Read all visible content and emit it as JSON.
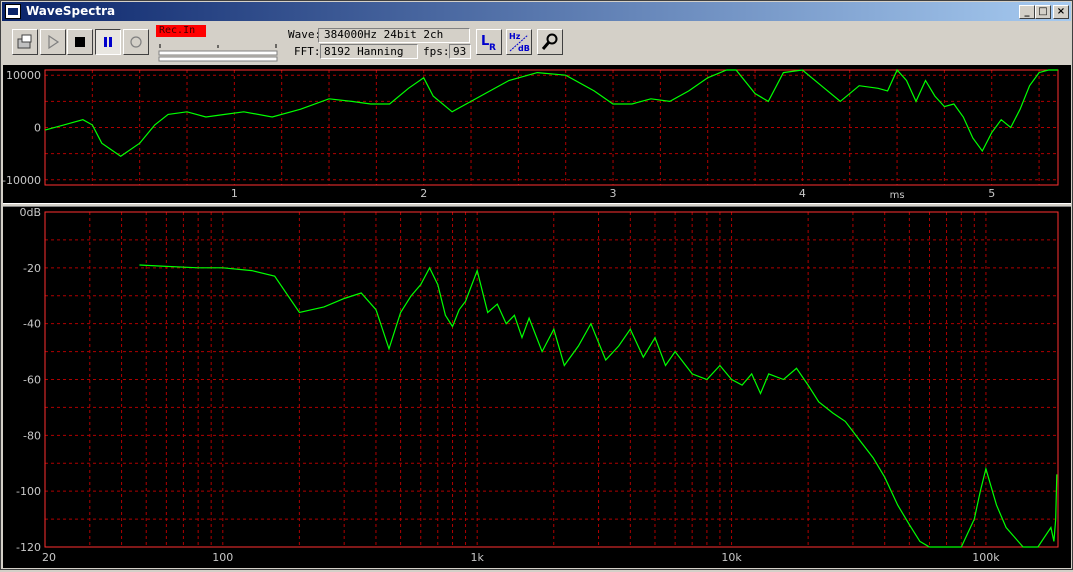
{
  "window": {
    "title": "WaveSpectra"
  },
  "caption_buttons": {
    "minimize": "_",
    "maximize": "□",
    "close": "×"
  },
  "toolbar": {
    "rec_in_label": "Rec.In",
    "wave_label": "Wave:",
    "wave_value": "384000Hz 24bit 2ch",
    "fft_label": "FFT:",
    "fft_value": "8192 Hanning",
    "fps_label": "fps:",
    "fps_value": "93",
    "buttons": [
      {
        "name": "open-file-button",
        "icon": "folder-icon"
      },
      {
        "name": "play-button",
        "icon": "play-icon"
      },
      {
        "name": "stop-button",
        "icon": "stop-icon"
      },
      {
        "name": "pause-button",
        "icon": "pause-icon",
        "pressed": true
      },
      {
        "name": "record-button",
        "icon": "record-icon"
      },
      {
        "name": "channel-lr-button",
        "icon": "lr-icon"
      },
      {
        "name": "hz-db-button",
        "icon": "hz-db-icon"
      },
      {
        "name": "settings-button",
        "icon": "wrench-icon"
      }
    ]
  },
  "colors": {
    "trace": "#00ff00",
    "grid": "#b00000",
    "frame": "#ff3030",
    "axis_text": "#c8c8c8"
  },
  "chart_data": [
    {
      "type": "line",
      "name": "waveform",
      "xlabel": "ms",
      "xlim": [
        0,
        5.35
      ],
      "ylim": [
        -11000,
        11000
      ],
      "x_ticks": [
        1,
        2,
        3,
        4,
        5
      ],
      "x_tick_labels": [
        "1",
        "2",
        "3",
        "4",
        "5"
      ],
      "y_ticks": [
        10000,
        0,
        -10000
      ],
      "y_tick_labels": [
        "10000",
        "0",
        "-10000"
      ],
      "grid": true,
      "series": [
        {
          "x": [
            0,
            0.1,
            0.2,
            0.25,
            0.3,
            0.4,
            0.5,
            0.58,
            0.65,
            0.75,
            0.85,
            0.95,
            1.05,
            1.2,
            1.35,
            1.5,
            1.62,
            1.72,
            1.82,
            1.92,
            2.0,
            2.05,
            2.15,
            2.3,
            2.45,
            2.6,
            2.75,
            2.9,
            3.0,
            3.1,
            3.2,
            3.3,
            3.4,
            3.5,
            3.6,
            3.65,
            3.75,
            3.82,
            3.9,
            4.0,
            4.1,
            4.2,
            4.3,
            4.4,
            4.45,
            4.5,
            4.55,
            4.6,
            4.65,
            4.7,
            4.75,
            4.8,
            4.85,
            4.9,
            4.95,
            5.0,
            5.05,
            5.1,
            5.15,
            5.2,
            5.25,
            5.3,
            5.35
          ],
          "y": [
            -500,
            500,
            1500,
            500,
            -3000,
            -5500,
            -3000,
            500,
            2500,
            3000,
            2000,
            2500,
            3000,
            2000,
            3500,
            5500,
            5000,
            4500,
            4500,
            7500,
            9500,
            6000,
            3000,
            6000,
            9000,
            10500,
            10000,
            7000,
            4500,
            4500,
            5500,
            5000,
            7000,
            9500,
            11500,
            12000,
            6500,
            5000,
            10500,
            12000,
            8000,
            5000,
            8000,
            7500,
            7000,
            11000,
            9000,
            5000,
            9000,
            6000,
            4000,
            4500,
            2000,
            -2000,
            -4500,
            -1000,
            1500,
            0,
            3500,
            8000,
            10500,
            11000,
            11000
          ]
        }
      ]
    },
    {
      "type": "line",
      "name": "spectrum",
      "xlabel": "",
      "ylabel": "",
      "x_scale": "log",
      "xlim": [
        20,
        192000
      ],
      "ylim": [
        -120,
        0
      ],
      "x_ticks": [
        20,
        100,
        1000,
        10000,
        100000
      ],
      "x_tick_labels": [
        "20",
        "100",
        "1k",
        "10k",
        "100k"
      ],
      "y_ticks": [
        0,
        -20,
        -40,
        -60,
        -80,
        -100,
        -120
      ],
      "y_tick_labels": [
        "0dB",
        "-20",
        "-40",
        "-60",
        "-80",
        "-100",
        "-120"
      ],
      "grid": true,
      "series": [
        {
          "x": [
            47,
            60,
            80,
            100,
            130,
            160,
            200,
            250,
            300,
            350,
            400,
            450,
            500,
            550,
            600,
            650,
            700,
            750,
            800,
            850,
            900,
            1000,
            1100,
            1200,
            1300,
            1400,
            1500,
            1600,
            1800,
            2000,
            2200,
            2500,
            2800,
            3200,
            3600,
            4000,
            4500,
            5000,
            5500,
            6000,
            7000,
            8000,
            9000,
            10000,
            11000,
            12000,
            13000,
            14000,
            16000,
            18000,
            20000,
            22000,
            25000,
            28000,
            32000,
            36000,
            40000,
            45000,
            50000,
            55000,
            60000,
            70000,
            80000,
            90000,
            95000,
            100000,
            110000,
            120000,
            140000,
            160000,
            180000,
            185000,
            188000,
            190000
          ],
          "y": [
            -19,
            -19.5,
            -20,
            -20,
            -21,
            -23,
            -36,
            -34,
            -31,
            -29,
            -35,
            -49,
            -36,
            -30,
            -26,
            -20,
            -26,
            -37,
            -41,
            -35,
            -32,
            -21,
            -36,
            -33,
            -40,
            -37,
            -45,
            -38,
            -50,
            -42,
            -55,
            -48,
            -40,
            -53,
            -48,
            -42,
            -52,
            -45,
            -55,
            -50,
            -58,
            -60,
            -55,
            -60,
            -62,
            -58,
            -65,
            -58,
            -60,
            -56,
            -62,
            -68,
            -72,
            -75,
            -82,
            -88,
            -95,
            -105,
            -112,
            -118,
            -120,
            -120,
            -120,
            -110,
            -100,
            -92,
            -105,
            -113,
            -120,
            -120,
            -113,
            -118,
            -110,
            -94
          ]
        }
      ]
    }
  ]
}
